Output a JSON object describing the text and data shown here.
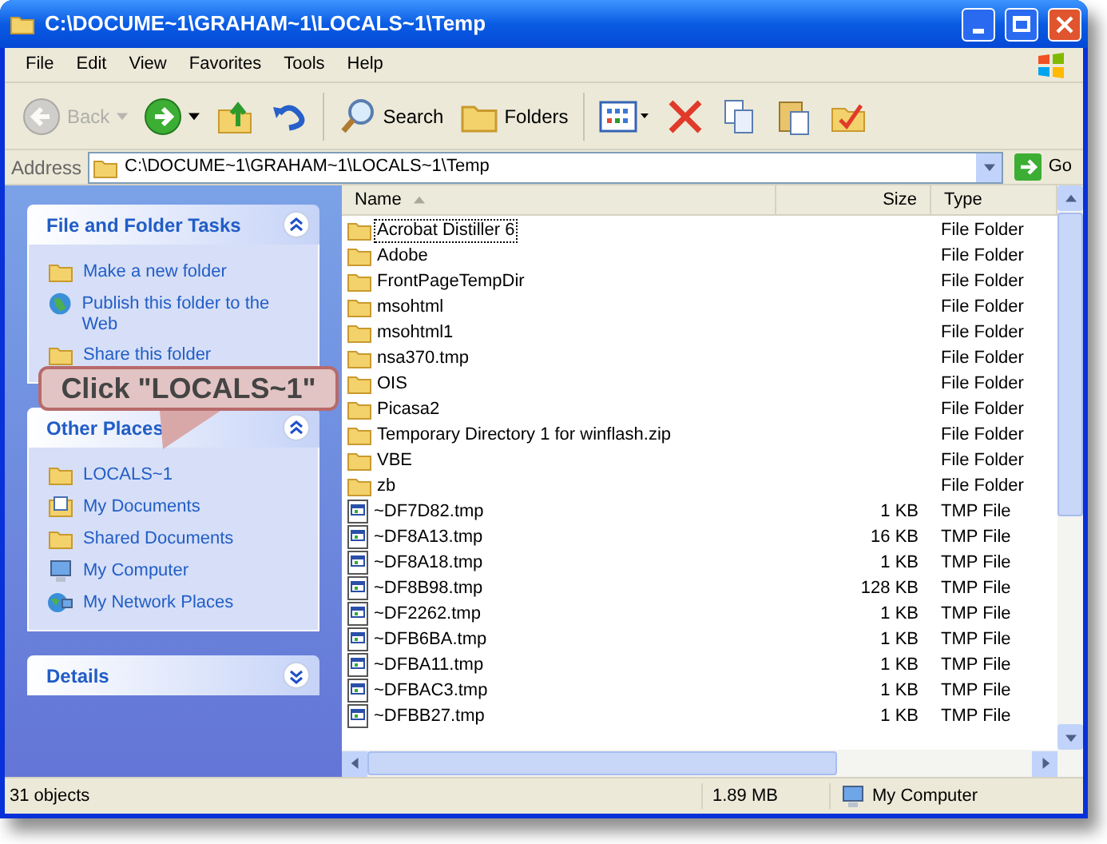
{
  "window": {
    "title": "C:\\DOCUME~1\\GRAHAM~1\\LOCALS~1\\Temp"
  },
  "menu": [
    "File",
    "Edit",
    "View",
    "Favorites",
    "Tools",
    "Help"
  ],
  "toolbar": [
    {
      "kind": "back",
      "label": "Back",
      "disabled": true
    },
    {
      "kind": "forward",
      "disabled": false
    },
    {
      "kind": "up",
      "disabled": false
    },
    {
      "kind": "undo",
      "disabled": false
    },
    {
      "kind": "search",
      "label": "Search",
      "disabled": false
    },
    {
      "kind": "folders",
      "label": "Folders",
      "disabled": false
    },
    {
      "kind": "views",
      "disabled": false
    },
    {
      "kind": "delete",
      "disabled": false
    },
    {
      "kind": "copy",
      "disabled": false
    },
    {
      "kind": "paste",
      "disabled": false
    },
    {
      "kind": "properties",
      "disabled": false
    }
  ],
  "address": {
    "label": "Address",
    "value": "C:\\DOCUME~1\\GRAHAM~1\\LOCALS~1\\Temp",
    "go": "Go"
  },
  "sidebar": [
    {
      "title": "File and Folder Tasks",
      "expanded": true,
      "items": [
        {
          "label": "Make a new folder",
          "kind": "newfolder"
        },
        {
          "label": "Publish this folder to the Web",
          "kind": "web"
        },
        {
          "label": "Share this folder",
          "kind": "share"
        }
      ]
    },
    {
      "title": "Other Places",
      "expanded": true,
      "items": [
        {
          "label": "LOCALS~1",
          "kind": "folder"
        },
        {
          "label": "My Documents",
          "kind": "documents"
        },
        {
          "label": "Shared Documents",
          "kind": "folder"
        },
        {
          "label": "My Computer",
          "kind": "computer"
        },
        {
          "label": "My Network Places",
          "kind": "network"
        }
      ]
    },
    {
      "title": "Details",
      "expanded": false
    }
  ],
  "table": {
    "columns": [
      {
        "label": "Name",
        "sorted": true
      },
      {
        "label": "Size",
        "sorted": false
      },
      {
        "label": "Type",
        "sorted": false
      }
    ],
    "rows": [
      {
        "name": "Acrobat Distiller 6",
        "size": "",
        "type": "File Folder",
        "kind": "folder",
        "focused": true
      },
      {
        "name": "Adobe",
        "size": "",
        "type": "File Folder",
        "kind": "folder",
        "focused": false
      },
      {
        "name": "FrontPageTempDir",
        "size": "",
        "type": "File Folder",
        "kind": "folder",
        "focused": false
      },
      {
        "name": "msohtml",
        "size": "",
        "type": "File Folder",
        "kind": "folder",
        "focused": false
      },
      {
        "name": "msohtml1",
        "size": "",
        "type": "File Folder",
        "kind": "folder",
        "focused": false
      },
      {
        "name": "nsa370.tmp",
        "size": "",
        "type": "File Folder",
        "kind": "folder",
        "focused": false
      },
      {
        "name": "OIS",
        "size": "",
        "type": "File Folder",
        "kind": "folder",
        "focused": false
      },
      {
        "name": "Picasa2",
        "size": "",
        "type": "File Folder",
        "kind": "folder",
        "focused": false
      },
      {
        "name": "Temporary Directory 1 for winflash.zip",
        "size": "",
        "type": "File Folder",
        "kind": "folder",
        "focused": false
      },
      {
        "name": "VBE",
        "size": "",
        "type": "File Folder",
        "kind": "folder",
        "focused": false
      },
      {
        "name": "zb",
        "size": "",
        "type": "File Folder",
        "kind": "folder",
        "focused": false
      },
      {
        "name": "~DF7D82.tmp",
        "size": "1 KB",
        "type": "TMP File",
        "kind": "file",
        "focused": false
      },
      {
        "name": "~DF8A13.tmp",
        "size": "16 KB",
        "type": "TMP File",
        "kind": "file",
        "focused": false
      },
      {
        "name": "~DF8A18.tmp",
        "size": "1 KB",
        "type": "TMP File",
        "kind": "file",
        "focused": false
      },
      {
        "name": "~DF8B98.tmp",
        "size": "128 KB",
        "type": "TMP File",
        "kind": "file",
        "focused": false
      },
      {
        "name": "~DF2262.tmp",
        "size": "1 KB",
        "type": "TMP File",
        "kind": "file",
        "focused": false
      },
      {
        "name": "~DFB6BA.tmp",
        "size": "1 KB",
        "type": "TMP File",
        "kind": "file",
        "focused": false
      },
      {
        "name": "~DFBA11.tmp",
        "size": "1 KB",
        "type": "TMP File",
        "kind": "file",
        "focused": false
      },
      {
        "name": "~DFBAC3.tmp",
        "size": "1 KB",
        "type": "TMP File",
        "kind": "file",
        "focused": false
      },
      {
        "name": "~DFBB27.tmp",
        "size": "1 KB",
        "type": "TMP File",
        "kind": "file",
        "focused": false
      }
    ]
  },
  "status_bar": {
    "objects": "31 objects",
    "size": "1.89 MB",
    "zone": "My Computer"
  },
  "callout": {
    "text": "Click \"LOCALS~1\""
  }
}
